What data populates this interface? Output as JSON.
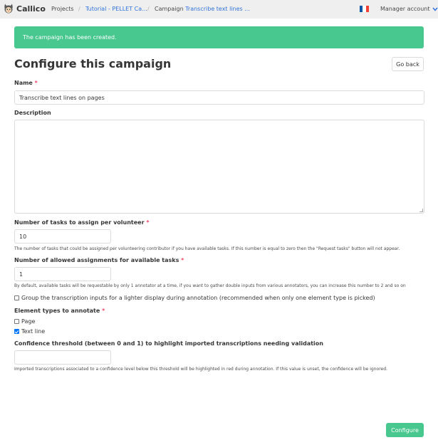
{
  "navbar": {
    "brand": "Callico",
    "projects": "Projects",
    "separator": "/",
    "breadcrumb_project": "Tutorial - PELLET Ca...",
    "breadcrumb_campaign_prefix": "Campaign",
    "breadcrumb_campaign_name": "Transcribe text lines ...",
    "flag_colors": [
      "#0055a4",
      "#ffffff",
      "#ef4135"
    ],
    "account": "Manager account",
    "account_icon": "chevron-down-icon"
  },
  "notification": {
    "text": "The campaign has been created."
  },
  "page": {
    "title": "Configure this campaign",
    "go_back": "Go back"
  },
  "form": {
    "required_mark": "*",
    "name_label": "Name",
    "name_value": "Transcribe text lines on pages",
    "description_label": "Description",
    "description_value": "",
    "tasks_label": "Number of tasks to assign per volunteer",
    "tasks_value": "10",
    "tasks_help": "The number of tasks that could be assigned per volunteering contributor if you have available tasks. If this number is equal to zero then the \"Request tasks\" button will not appear.",
    "assign_label": "Number of allowed assignments for available tasks",
    "assign_value": "1",
    "assign_help": "By default, available tasks will be requestable by only 1 annotator at a time, if you want to gather double inputs from various annotators, you can increase this number to 2 and so on",
    "group_label": "Group the transcription inputs for a lighter display during annotation (recommended when only one element type is picked)",
    "group_checked": false,
    "types_label": "Element types to annotate",
    "types": [
      {
        "label": "Page",
        "checked": false
      },
      {
        "label": "Text line",
        "checked": true
      }
    ],
    "threshold_label": "Confidence threshold (between 0 and 1) to highlight imported transcriptions needing validation",
    "threshold_value": "",
    "threshold_help": "Imported transcriptions associated to a confidence level below this threshold will be highlighted in red during annotation. If this value is unset, the confidence will be ignored."
  },
  "actions": {
    "configure": "Configure"
  },
  "colors": {
    "accent": "#48c78e",
    "link": "#3273dc",
    "required": "#f14668"
  }
}
